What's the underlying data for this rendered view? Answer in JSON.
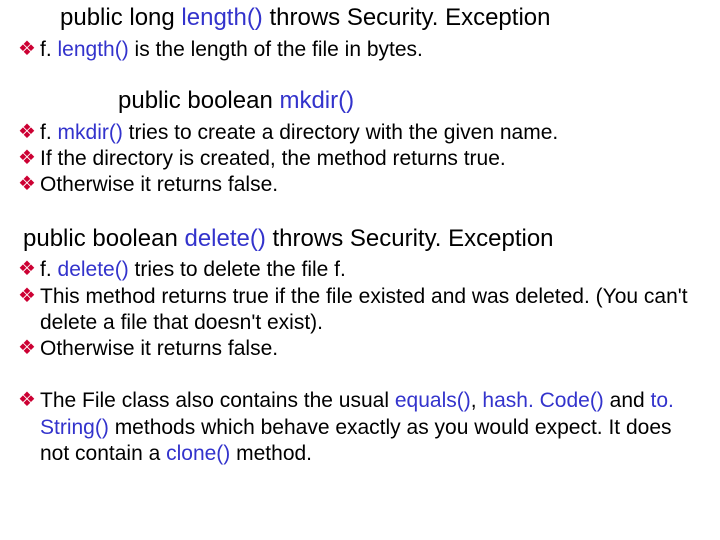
{
  "section1": {
    "heading_pre": "public long ",
    "heading_hl": "length()",
    "heading_post": " throws Security. Exception",
    "bullets": [
      {
        "pre": "f. ",
        "hl": "length()",
        "post": " is the length of the file in bytes."
      }
    ]
  },
  "section2": {
    "heading_pre": "public boolean ",
    "heading_hl": "mkdir()",
    "heading_post": "",
    "bullets": [
      {
        "pre": "f. ",
        "hl": "mkdir()",
        "post": " tries to create a directory with the given name."
      },
      {
        "pre": "If the directory is created, the method returns true.",
        "hl": "",
        "post": ""
      },
      {
        "pre": "Otherwise it returns false.",
        "hl": "",
        "post": ""
      }
    ]
  },
  "section3": {
    "heading_pre": "public boolean ",
    "heading_hl": "delete()",
    "heading_post": " throws Security. Exception",
    "bullets": [
      {
        "pre": "f. ",
        "hl": "delete()",
        "post": " tries to delete the file f."
      },
      {
        "pre": "This method returns true if the file existed and was deleted. (You can't delete a file that doesn't exist).",
        "hl": "",
        "post": ""
      },
      {
        "pre": "Otherwise it returns false.",
        "hl": "",
        "post": ""
      }
    ]
  },
  "section4": {
    "b0_pre": "The File class also contains the usual ",
    "b0_hl1": "equals()",
    "b0_mid1": ", ",
    "b0_hl2": "hash. Code()",
    "b0_mid2": " and ",
    "b0_hl3": "to. String()",
    "b0_mid3": " methods which behave exactly as you would expect. It does not contain a ",
    "b0_hl4": "clone()",
    "b0_post": " method."
  },
  "bullet_glyph": "❖"
}
